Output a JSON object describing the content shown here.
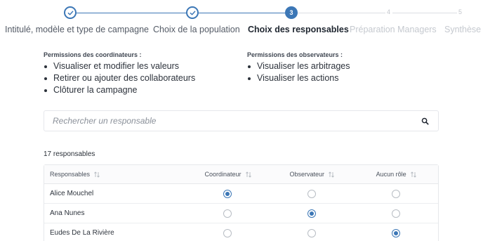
{
  "colors": {
    "accent": "#3c77b6",
    "pending": "#dcdfe4"
  },
  "stepper": {
    "steps": [
      {
        "label": "Intitulé, modèle et type de campagne",
        "state": "done"
      },
      {
        "label": "Choix de la population",
        "state": "done"
      },
      {
        "label": "Choix des responsables",
        "state": "current",
        "number": "3"
      },
      {
        "label": "Préparation Managers",
        "state": "pending",
        "number": "4"
      },
      {
        "label": "Synthèse",
        "state": "pending",
        "number": "5"
      }
    ]
  },
  "permissions": {
    "coordinators": {
      "title": "Permissions des coordinateurs :",
      "items": [
        "Visualiser et modifier les valeurs",
        "Retirer ou ajouter des collaborateurs",
        "Clôturer la campagne"
      ]
    },
    "observers": {
      "title": "Permissions des observateurs :",
      "items": [
        "Visualiser les arbitrages",
        "Visualiser les actions"
      ]
    }
  },
  "search": {
    "placeholder": "Rechercher un responsable",
    "value": "",
    "icon": "search-icon"
  },
  "count_label": "17 responsables",
  "table": {
    "columns": [
      "Responsables",
      "Coordinateur",
      "Observateur",
      "Aucun rôle"
    ],
    "rows": [
      {
        "name": "Alice Mouchel",
        "role": "Coordinateur"
      },
      {
        "name": "Ana Nunes",
        "role": "Observateur"
      },
      {
        "name": "Eudes De La Rivière",
        "role": "Aucun rôle"
      }
    ]
  }
}
